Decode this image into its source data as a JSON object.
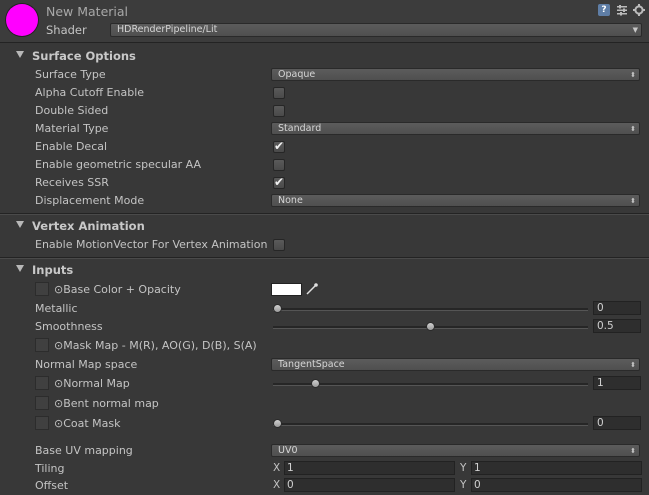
{
  "header": {
    "material_name": "New Material",
    "shader_label": "Shader",
    "shader_value": "HDRenderPipeline/Lit",
    "preview_color": "#ff00ff",
    "icons": [
      "help-icon",
      "presets-icon",
      "gear-icon"
    ]
  },
  "surface_options": {
    "title": "Surface Options",
    "surface_type": {
      "label": "Surface Type",
      "value": "Opaque"
    },
    "alpha_cutoff": {
      "label": "Alpha Cutoff Enable",
      "checked": false
    },
    "double_sided": {
      "label": "Double Sided",
      "checked": false
    },
    "material_type": {
      "label": "Material Type",
      "value": "Standard"
    },
    "enable_decal": {
      "label": "Enable Decal",
      "checked": true
    },
    "specular_aa": {
      "label": "Enable geometric specular AA",
      "checked": false
    },
    "receives_ssr": {
      "label": "Receives SSR",
      "checked": true
    },
    "displacement": {
      "label": "Displacement Mode",
      "value": "None"
    }
  },
  "vertex_animation": {
    "title": "Vertex Animation",
    "motion_vector": {
      "label": "Enable MotionVector For Vertex Animation",
      "checked": false
    }
  },
  "inputs": {
    "title": "Inputs",
    "base_color": {
      "label": "Base Color + Opacity",
      "color": "#ffffff"
    },
    "metallic": {
      "label": "Metallic",
      "value": "0",
      "fraction": 0.0
    },
    "smoothness": {
      "label": "Smoothness",
      "value": "0.5",
      "fraction": 0.5
    },
    "mask_map": {
      "label": "Mask Map - M(R), AO(G), D(B), S(A)"
    },
    "normal_map_space": {
      "label": "Normal Map space",
      "value": "TangentSpace"
    },
    "normal_map": {
      "label": "Normal Map",
      "value": "1",
      "fraction": 0.125
    },
    "bent_normal": {
      "label": "Bent normal map"
    },
    "coat_mask": {
      "label": "Coat Mask",
      "value": "0",
      "fraction": 0.0
    },
    "base_uv": {
      "label": "Base UV mapping",
      "value": "UV0"
    },
    "tiling": {
      "label": "Tiling",
      "x_label": "X",
      "x": "1",
      "y_label": "Y",
      "y": "1"
    },
    "offset": {
      "label": "Offset",
      "x_label": "X",
      "x": "0",
      "y_label": "Y",
      "y": "0"
    }
  }
}
